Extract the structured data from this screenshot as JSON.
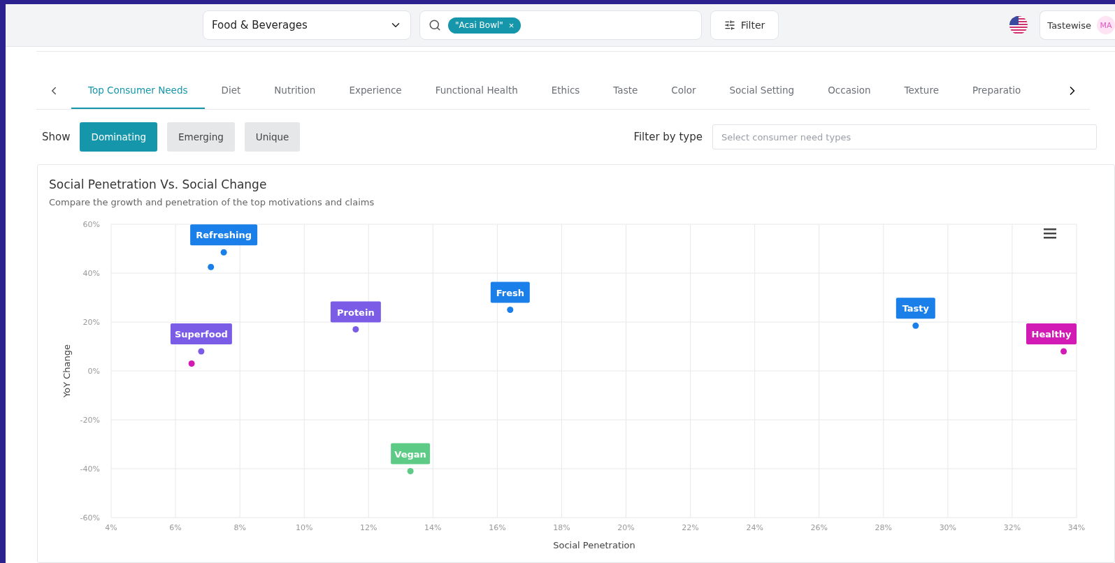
{
  "top_bar": {
    "category_dropdown": {
      "value": "Food & Beverages"
    },
    "search": {
      "chips": [
        {
          "label": "\"Acai Bowl\"",
          "close": "×"
        }
      ]
    },
    "filter_button": {
      "label": "Filter"
    },
    "account": {
      "name": "Tastewise",
      "initials": "MA"
    }
  },
  "tabs": [
    {
      "label": "Top Consumer Needs",
      "selected": true
    },
    {
      "label": "Diet",
      "selected": false
    },
    {
      "label": "Nutrition",
      "selected": false
    },
    {
      "label": "Experience",
      "selected": false
    },
    {
      "label": "Functional Health",
      "selected": false
    },
    {
      "label": "Ethics",
      "selected": false
    },
    {
      "label": "Taste",
      "selected": false
    },
    {
      "label": "Color",
      "selected": false
    },
    {
      "label": "Social Setting",
      "selected": false
    },
    {
      "label": "Occasion",
      "selected": false
    },
    {
      "label": "Texture",
      "selected": false
    },
    {
      "label": "Preparatio",
      "selected": false
    }
  ],
  "show": {
    "label": "Show",
    "options": [
      {
        "label": "Dominating",
        "selected": true
      },
      {
        "label": "Emerging",
        "selected": false
      },
      {
        "label": "Unique",
        "selected": false
      }
    ]
  },
  "filter_by_type": {
    "label": "Filter by type",
    "placeholder": "Select consumer need types"
  },
  "chart": {
    "title": "Social Penetration Vs. Social Change",
    "subtitle": "Compare the growth and penetration of the top motivations and claims",
    "chart_data": {
      "type": "scatter",
      "xlabel": "Social Penetration",
      "ylabel": "YoY Change",
      "xlim": [
        4,
        34
      ],
      "ylim": [
        -60,
        60
      ],
      "xticks": [
        {
          "value": 4,
          "label": "4%"
        },
        {
          "value": 6,
          "label": "6%"
        },
        {
          "value": 8,
          "label": "8%"
        },
        {
          "value": 10,
          "label": "10%"
        },
        {
          "value": 12,
          "label": "12%"
        },
        {
          "value": 14,
          "label": "14%"
        },
        {
          "value": 16,
          "label": "16%"
        },
        {
          "value": 18,
          "label": "18%"
        },
        {
          "value": 20,
          "label": "20%"
        },
        {
          "value": 22,
          "label": "22%"
        },
        {
          "value": 24,
          "label": "24%"
        },
        {
          "value": 26,
          "label": "26%"
        },
        {
          "value": 28,
          "label": "28%"
        },
        {
          "value": 30,
          "label": "30%"
        },
        {
          "value": 32,
          "label": "32%"
        },
        {
          "value": 34,
          "label": "34%"
        }
      ],
      "yticks": [
        {
          "value": 60,
          "label": "60%"
        },
        {
          "value": 40,
          "label": "40%"
        },
        {
          "value": 20,
          "label": "20%"
        },
        {
          "value": 0,
          "label": "0%"
        },
        {
          "value": -20,
          "label": "-20%"
        },
        {
          "value": -40,
          "label": "-40%"
        },
        {
          "value": -60,
          "label": "-60%"
        }
      ],
      "series": [
        {
          "color": "#1a7fe8",
          "x": [
            7.5,
            7.1,
            16.4,
            29
          ],
          "values": [
            48.5,
            42.5,
            25,
            18.5
          ]
        },
        {
          "color": "#7b5ce6",
          "x": [
            6.8,
            11.6
          ],
          "values": [
            8,
            17
          ]
        },
        {
          "color": "#d21bb5",
          "x": [
            6.5,
            33.6
          ],
          "values": [
            3,
            8
          ]
        },
        {
          "color": "#5dcb86",
          "x": [
            13.3
          ],
          "values": [
            -41
          ]
        }
      ],
      "grid": true,
      "annotations": [
        {
          "x": 7.5,
          "y": 48.5,
          "text": "Refreshing"
        },
        {
          "x": 16.4,
          "y": 25,
          "text": "Fresh"
        },
        {
          "x": 29,
          "y": 18.5,
          "text": "Tasty"
        },
        {
          "x": 6.8,
          "y": 8,
          "text": "Superfood"
        },
        {
          "x": 11.6,
          "y": 17,
          "text": "Protein"
        },
        {
          "x": 33.6,
          "y": 8,
          "text": "Healthy"
        },
        {
          "x": 13.3,
          "y": -41,
          "text": "Vegan"
        }
      ]
    }
  }
}
